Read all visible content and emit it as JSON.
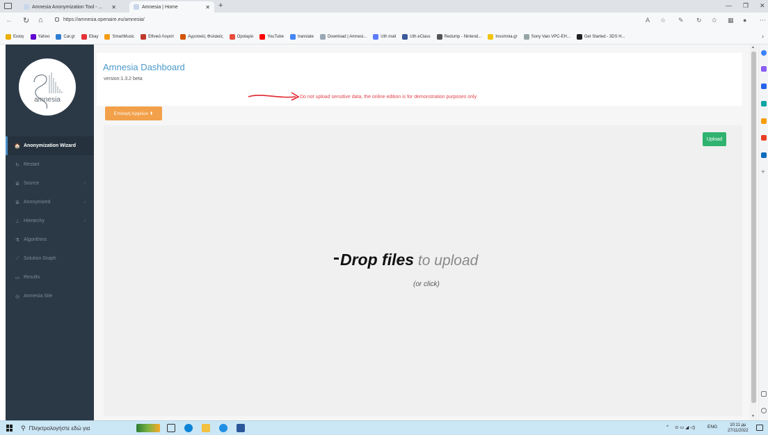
{
  "browser": {
    "tabs": [
      {
        "label": "Amnesia Anonymization Tool - ...",
        "active": false
      },
      {
        "label": "Amnesia | Home",
        "active": true
      }
    ],
    "new_tab": "+",
    "url": "https://amnesia.openaire.eu/amnesia/",
    "favorites": [
      {
        "label": "Εισαγ",
        "color": "#e9b000"
      },
      {
        "label": "Yahoo",
        "color": "#6001d2"
      },
      {
        "label": "Car.gr",
        "color": "#2f7dd1"
      },
      {
        "label": "Ebay",
        "color": "#e53238"
      },
      {
        "label": "SmartMusic",
        "color": "#f39c12"
      },
      {
        "label": "Εθνικό Λογιστ",
        "color": "#c0392b"
      },
      {
        "label": "Αγροτικές Φυλακές",
        "color": "#d35400"
      },
      {
        "label": "Opolayio",
        "color": "#e74c3c"
      },
      {
        "label": "YouTube",
        "color": "#ff0000"
      },
      {
        "label": "translate",
        "color": "#4285f4"
      },
      {
        "label": "Download | Amnesi...",
        "color": "#9aa7b5"
      },
      {
        "label": "Uth mail",
        "color": "#5c7cfa"
      },
      {
        "label": "Uth eClass",
        "color": "#3b5998"
      },
      {
        "label": "Redump - Nintend...",
        "color": "#555555"
      },
      {
        "label": "Insomnia.gr",
        "color": "#f1c40f"
      },
      {
        "label": "Sony Vaio VPC-EH...",
        "color": "#95a5a6"
      },
      {
        "label": "Get Started - 3DS H...",
        "color": "#222222"
      }
    ],
    "more_favorites": "›"
  },
  "sidebar": {
    "logo_text": "amnesia",
    "items": [
      {
        "label": "Anonymization Wizard",
        "icon": "home-icon",
        "glyph": "🏠",
        "active": true,
        "has_chevron": false
      },
      {
        "label": "Restart",
        "icon": "refresh-icon",
        "glyph": "↻",
        "active": false,
        "has_chevron": false
      },
      {
        "label": "Source",
        "icon": "database-icon",
        "glyph": "≣",
        "active": false,
        "has_chevron": true
      },
      {
        "label": "Anonymized",
        "icon": "database-icon",
        "glyph": "≣",
        "active": false,
        "has_chevron": true
      },
      {
        "label": "Hierarchy",
        "icon": "hierarchy-icon",
        "glyph": "⊥",
        "active": false,
        "has_chevron": true
      },
      {
        "label": "Algorithms",
        "icon": "flask-icon",
        "glyph": "⚗",
        "active": false,
        "has_chevron": false
      },
      {
        "label": "Solution Graph",
        "icon": "line-chart-icon",
        "glyph": "⟋",
        "active": false,
        "has_chevron": false
      },
      {
        "label": "Results",
        "icon": "results-icon",
        "glyph": "▭",
        "active": false,
        "has_chevron": false
      },
      {
        "label": "Amnesia Site",
        "icon": "globe-icon",
        "glyph": "◎",
        "active": false,
        "has_chevron": false
      }
    ],
    "chevron": "‹"
  },
  "main": {
    "title": "Amnesia Dashboard",
    "version": "version:1.3.2 beta",
    "warning": "Do not upload sensitive data, the online edition is for demonstration purposes only",
    "choose_button": "Επιλογή Αρχείων ⬆",
    "upload_button": "Upload",
    "drop_bold": "Drop files",
    "drop_light": " to upload",
    "drop_sub": "(or click)"
  },
  "taskbar": {
    "search_placeholder": "Πληκτρολογήστε εδώ για",
    "lang": "ENG",
    "time": "10:11 μμ",
    "date": "27/11/2022"
  },
  "colors": {
    "sidebar_bg": "#2b3946",
    "title_blue": "#4a9ac9",
    "warning_red": "#e0424a",
    "choose_orange": "#f2a04a",
    "upload_green": "#2fb36f"
  }
}
